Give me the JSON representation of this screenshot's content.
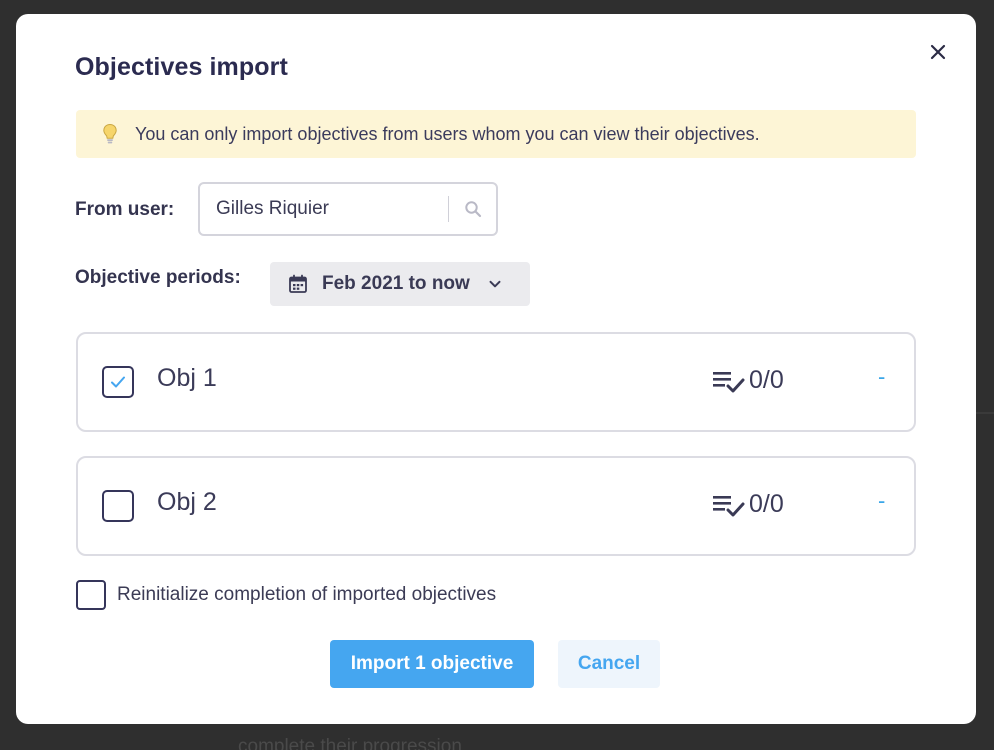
{
  "background": {
    "text_bottom": "complete their progression"
  },
  "modal": {
    "title": "Objectives import",
    "close_icon": "close-icon",
    "banner": {
      "icon": "lightbulb-icon",
      "text": "You can only import objectives from users whom you can view their objectives."
    },
    "from_user": {
      "label": "From user:",
      "value": "Gilles Riquier",
      "icon": "search-icon"
    },
    "periods": {
      "label": "Objective periods:",
      "value": "Feb 2021 to now",
      "icon": "calendar-icon"
    },
    "objectives": [
      {
        "name": "Obj 1",
        "checked": true,
        "count": "0/0",
        "action": "-"
      },
      {
        "name": "Obj 2",
        "checked": false,
        "count": "0/0",
        "action": "-"
      }
    ],
    "reinitialize": {
      "label": "Reinitialize completion of imported objectives",
      "checked": false
    },
    "buttons": {
      "import": "Import 1 objective",
      "cancel": "Cancel"
    }
  },
  "colors": {
    "accent": "#45a6f0",
    "banner_bg": "#fdf5d6",
    "text": "#303051"
  }
}
